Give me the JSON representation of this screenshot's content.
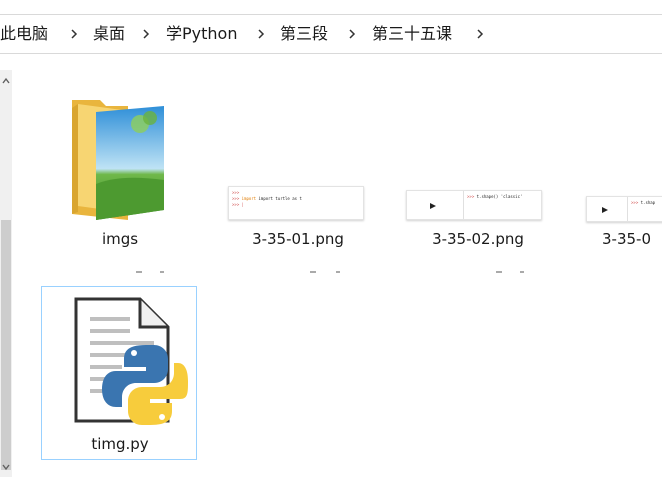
{
  "breadcrumb": {
    "items": [
      "此电脑",
      "桌面",
      "学Python",
      "第三段",
      "第三十五课"
    ]
  },
  "files": [
    {
      "name": "imgs",
      "type": "folder"
    },
    {
      "name": "3-35-01.png",
      "type": "image",
      "preview_text": "import turtle as t"
    },
    {
      "name": "3-35-02.png",
      "type": "image",
      "preview_text": "t.shape() 'classic'"
    },
    {
      "name": "3-35-0",
      "type": "image",
      "preview_text": "t.shap"
    },
    {
      "name": "timg.py",
      "type": "python",
      "selected": true
    }
  ],
  "colors": {
    "selection_border": "#99d1ff",
    "folder": "#f4c84d",
    "python_blue": "#3a75b0",
    "python_yellow": "#f7cc3c"
  },
  "icons": {
    "breadcrumb_separator": "chevron-right-icon",
    "scroll_up": "chevron-up-icon",
    "scroll_down": "chevron-down-icon"
  }
}
